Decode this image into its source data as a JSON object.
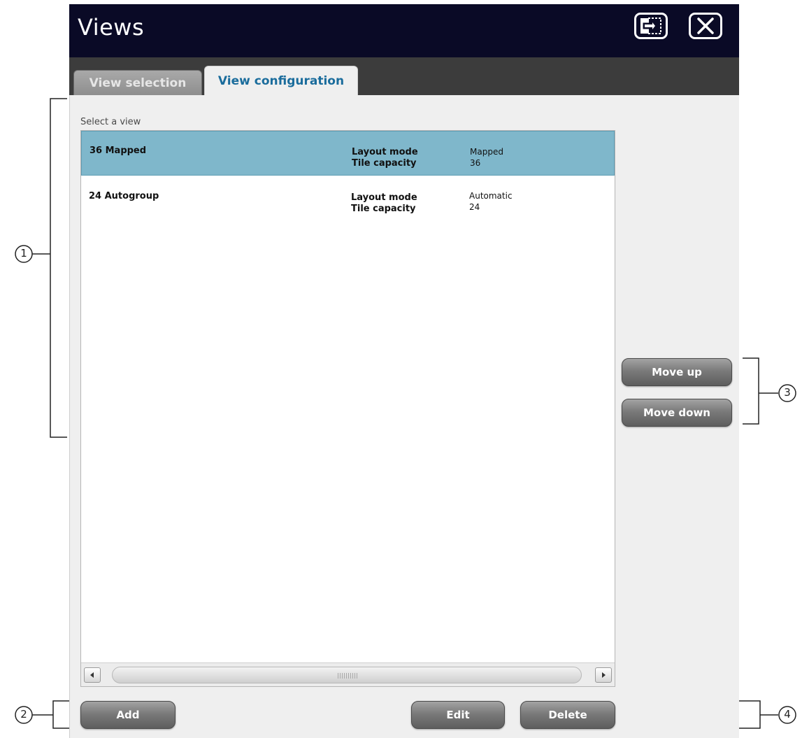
{
  "window": {
    "title": "Views"
  },
  "tabs": [
    {
      "label": "View selection",
      "active": false
    },
    {
      "label": "View configuration",
      "active": true
    }
  ],
  "main": {
    "select_label": "Select a view",
    "views": [
      {
        "name": "36 Mapped",
        "layout_mode_label": "Layout mode",
        "layout_mode": "Mapped",
        "tile_capacity_label": "Tile capacity",
        "tile_capacity": "36",
        "selected": true
      },
      {
        "name": "24 Autogroup",
        "layout_mode_label": "Layout mode",
        "layout_mode": "Automatic",
        "tile_capacity_label": "Tile capacity",
        "tile_capacity": "24",
        "selected": false
      }
    ]
  },
  "buttons": {
    "move_up": "Move up",
    "move_down": "Move down",
    "add": "Add",
    "edit": "Edit",
    "delete": "Delete"
  },
  "callouts": [
    "1",
    "2",
    "3",
    "4"
  ],
  "icons": {
    "exit": "exit-icon",
    "close": "close-icon",
    "scroll_left": "triangle-left-icon",
    "scroll_right": "triangle-right-icon"
  },
  "colors": {
    "titlebar": "#0a0a26",
    "tabstrip": "#3c3c3c",
    "active_tab_text": "#1a6c9c",
    "selected_row": "#7fb7cb",
    "panel": "#efefef"
  }
}
